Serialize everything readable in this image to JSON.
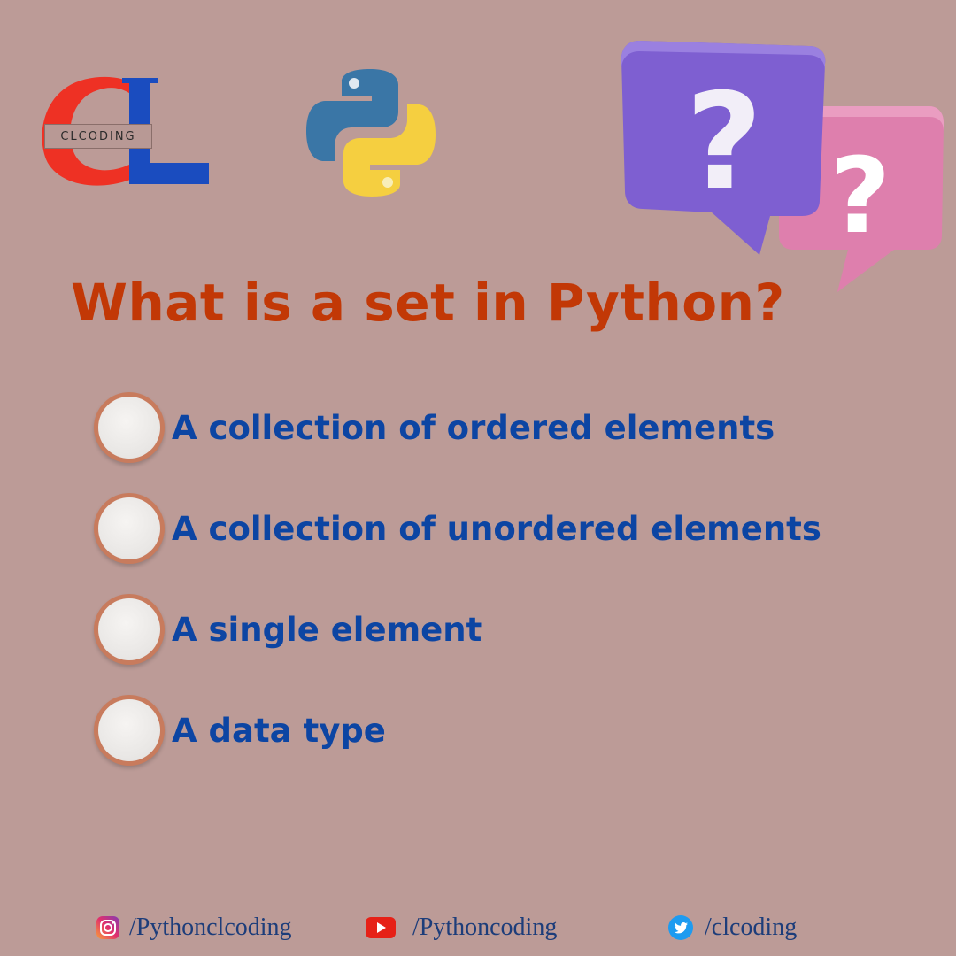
{
  "logo": {
    "label": "CLCODING"
  },
  "question": {
    "title": "What is a set in Python?"
  },
  "options": [
    {
      "label": "A collection of ordered elements"
    },
    {
      "label": "A collection of unordered elements"
    },
    {
      "label": "A single element"
    },
    {
      "label": "A data type"
    }
  ],
  "footer": {
    "instagram": {
      "icon": "instagram-icon",
      "handle": "/Pythonclcoding"
    },
    "youtube": {
      "icon": "youtube-icon",
      "handle": "/Pythoncoding"
    },
    "twitter": {
      "icon": "twitter-icon",
      "handle": "/clcoding"
    }
  },
  "colors": {
    "background": "#bc9b97",
    "title": "#c23806",
    "option_text": "#0c45a3",
    "logo_red": "#ee3124",
    "logo_blue": "#1a4cbf",
    "bubble_purple": "#7e5fd1",
    "bubble_pink": "#de7fad"
  }
}
